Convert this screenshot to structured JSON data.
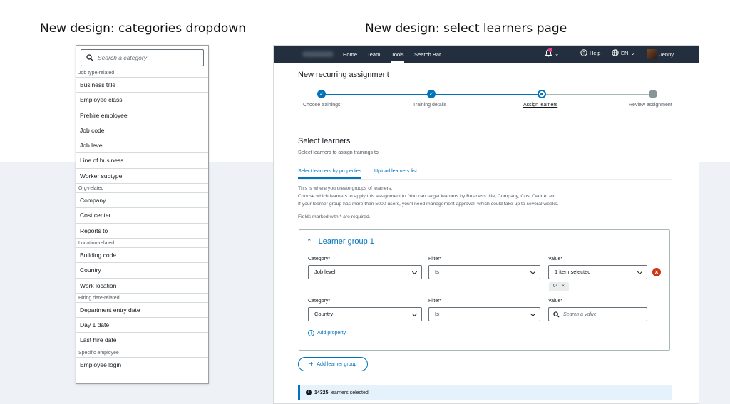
{
  "headings": {
    "left": "New design: categories dropdown",
    "right": "New design: select learners page"
  },
  "dropdown": {
    "search_placeholder": "Search a category",
    "groups": [
      {
        "label": "Job type-related",
        "items": [
          "Business title",
          "Employee class",
          "Prehire employee",
          "Job code",
          "Job level",
          "Line of business",
          "Worker subtype"
        ]
      },
      {
        "label": "Org-related",
        "items": [
          "Company",
          "Cost center",
          "Reports to"
        ]
      },
      {
        "label": "Location-related",
        "items": [
          "Building code",
          "Country",
          "Work location"
        ]
      },
      {
        "label": "Hiring date-related",
        "items": [
          "Department entry date",
          "Day 1 date",
          "Last hire date"
        ]
      },
      {
        "label": "Specific employee",
        "items": [
          "Employee login"
        ]
      }
    ]
  },
  "nav": {
    "links": [
      "Home",
      "Team",
      "Tools",
      "Search Bar"
    ],
    "active": "Tools",
    "help": "Help",
    "lang": "EN",
    "user": "Jenny"
  },
  "page": {
    "title": "New recurring assignment",
    "steps": [
      "Choose trainings",
      "Training details",
      "Assign learners",
      "Review assignment"
    ],
    "section_title": "Select learners",
    "section_sub": "Select learners to assign trainings to",
    "tabs": [
      "Select learners by properties",
      "Upload learners list"
    ],
    "desc": [
      "This is where you create groups of learners.",
      "Choose which learners to apply this assignment to. You can target learners by Business title, Company, Cost Centre, etc.",
      "If your learner group has more than 5000 users, you'll need management approval, which could take up to several weeks."
    ],
    "required_note": "Fields marked with * are required.",
    "group_title": "Learner group 1",
    "labels": {
      "category": "Category*",
      "filter": "Filter*",
      "value": "Value*"
    },
    "row1": {
      "category": "Job level",
      "filter": "Is",
      "value": "1 item selected",
      "chip": "04"
    },
    "row2": {
      "category": "Country",
      "filter": "Is",
      "value_placeholder": "Search a value"
    },
    "add_property": "Add property",
    "add_group": "Add learner group",
    "selected_count": "14325",
    "selected_suffix": "learners selected"
  },
  "colors": {
    "accent": "#0073bb",
    "nav_bg": "#232f3e",
    "error": "#d13212"
  }
}
